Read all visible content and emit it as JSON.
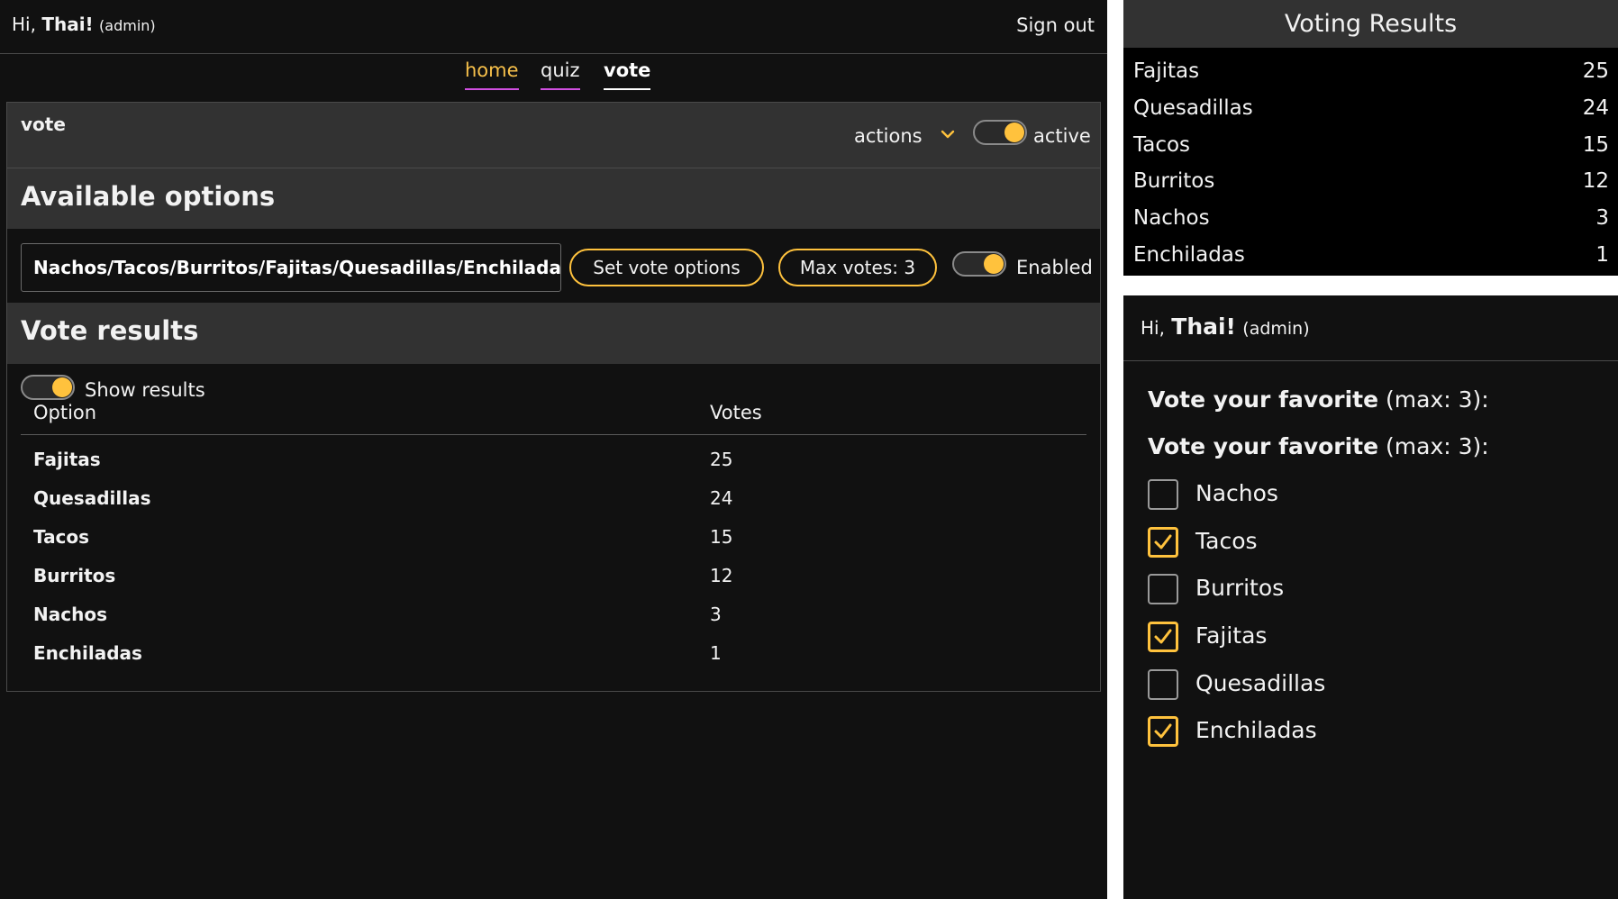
{
  "admin": {
    "greeting": {
      "hi": "Hi,",
      "name": "Thai!",
      "role": "(admin)"
    },
    "sign_out": "Sign out",
    "nav": [
      {
        "label": "home"
      },
      {
        "label": "quiz"
      },
      {
        "label": "vote"
      }
    ],
    "card": {
      "title": "vote",
      "actions_label": "actions",
      "active_label": "active",
      "active_on": true
    },
    "options_section": {
      "title": "Available options",
      "input_value": "Nachos/Tacos/Burritos/Fajitas/Quesadillas/Enchiladas",
      "set_button": "Set vote options",
      "max_votes_button": "Max votes: 3",
      "enabled_label": "Enabled",
      "enabled_on": true
    },
    "results_section": {
      "title": "Vote results",
      "show_results_label": "Show results",
      "show_results_on": true,
      "columns": [
        "Option",
        "Votes"
      ],
      "rows": [
        {
          "option": "Fajitas",
          "votes": "25"
        },
        {
          "option": "Quesadillas",
          "votes": "24"
        },
        {
          "option": "Tacos",
          "votes": "15"
        },
        {
          "option": "Burritos",
          "votes": "12"
        },
        {
          "option": "Nachos",
          "votes": "3"
        },
        {
          "option": "Enchiladas",
          "votes": "1"
        }
      ]
    }
  },
  "results_display": {
    "title": "Voting Results",
    "rows": [
      {
        "name": "Fajitas",
        "value": "25"
      },
      {
        "name": "Quesadillas",
        "value": "24"
      },
      {
        "name": "Tacos",
        "value": "15"
      },
      {
        "name": "Burritos",
        "value": "12"
      },
      {
        "name": "Nachos",
        "value": "3"
      },
      {
        "name": "Enchiladas",
        "value": "1"
      }
    ]
  },
  "voter": {
    "greeting": {
      "hi": "Hi,",
      "name": "Thai!",
      "role": "(admin)"
    },
    "prompts": [
      {
        "bold": "Vote your favorite",
        "rest": " (max: 3):"
      },
      {
        "bold": "Vote your favorite",
        "rest": " (max: 3):"
      }
    ],
    "options": [
      {
        "label": "Nachos",
        "checked": false
      },
      {
        "label": "Tacos",
        "checked": true
      },
      {
        "label": "Burritos",
        "checked": false
      },
      {
        "label": "Fajitas",
        "checked": true
      },
      {
        "label": "Quesadillas",
        "checked": false
      },
      {
        "label": "Enchiladas",
        "checked": true
      }
    ]
  },
  "colors": {
    "accent": "#ffc23d",
    "nav_underline": "#d04fe0",
    "background": "#111111",
    "panel_header": "#323232"
  }
}
